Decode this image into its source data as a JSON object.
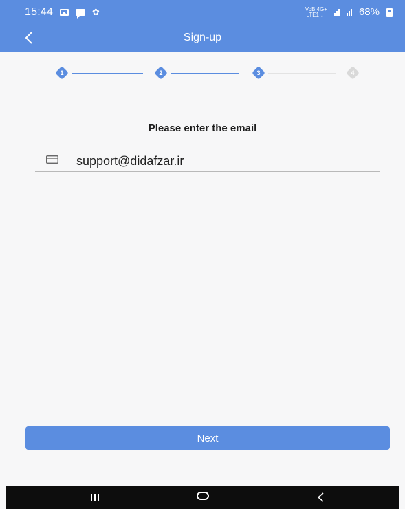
{
  "statusbar": {
    "time": "15:44",
    "network_top": "VoB 4G+",
    "network_bottom": "LTE1 ↓↑",
    "battery": "68%"
  },
  "appbar": {
    "title": "Sign-up",
    "back_icon": "chevron-left-icon"
  },
  "stepper": {
    "steps": [
      "1",
      "2",
      "3",
      "4"
    ],
    "current_step": 3,
    "active_color": "#5b8de0",
    "inactive_color": "#d9d9d9"
  },
  "form": {
    "prompt": "Please enter the email",
    "email_value": "support@didafzar.ir",
    "email_icon": "mail-icon"
  },
  "actions": {
    "next_label": "Next"
  },
  "navbar": {
    "icons": [
      "recents-icon",
      "home-icon",
      "back-icon"
    ]
  },
  "colors": {
    "primary": "#5b8de0",
    "background": "#f7f7f8"
  }
}
